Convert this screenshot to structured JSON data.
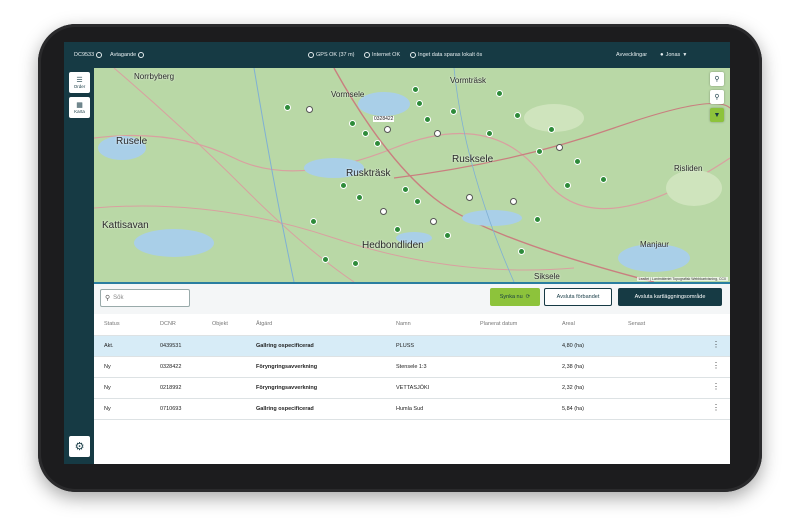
{
  "topbar": {
    "device_id": "DC9533",
    "sync_status": "Avtagande",
    "gps": "GPS OK (37 m)",
    "internet": "Internet OK",
    "offline_data": "Inget data sparas lokalt ös",
    "settings": "Avvecklingar",
    "user": "Jonas"
  },
  "sidebar": {
    "items": [
      {
        "label": "Order",
        "icon": "list-icon"
      },
      {
        "label": "Karta",
        "icon": "map-icon"
      }
    ],
    "settings_icon": "gear-icon"
  },
  "map": {
    "places": [
      "Norrbyberg",
      "Vormsele",
      "Vormträsk",
      "Ruselе",
      "Rusksele",
      "Ruskträsk",
      "Risliden",
      "Kattisavan",
      "Hedbondliden",
      "Manjaur",
      "Sikselе"
    ],
    "selected_label": "0328422",
    "attribution": "Leaflet | Lantmäteriet Topografisk Webbkartvisning, CC0"
  },
  "toolbar": {
    "search_placeholder": "Sök",
    "sync_button": "Synka nu",
    "reference_button": "Avsluta förbandet",
    "plan_button": "Avsluta kartläggningsområde"
  },
  "table": {
    "headers": [
      "Status",
      "DCNR",
      "Objekt",
      "Åtgärd",
      "Namn",
      "Planerat datum",
      "Areal",
      "Senast"
    ],
    "rows": [
      {
        "status": "Akt.",
        "dcnr": "0439531",
        "action": "Gallring ospecificerad",
        "name": "PLUSS",
        "area": "4,80 (ha)"
      },
      {
        "status": "Ny",
        "dcnr": "0328422",
        "action": "Föryngringsavverkning",
        "name": "Stensele 1:3",
        "area": "2,38 (ha)"
      },
      {
        "status": "Ny",
        "dcnr": "0218992",
        "action": "Föryngringsavverkning",
        "name": "VETTASJÖKI",
        "area": "2,32 (ha)"
      },
      {
        "status": "Ny",
        "dcnr": "0710693",
        "action": "Gallring ospecificerad",
        "name": "Humla Sud",
        "area": "5,84 (ha)"
      }
    ]
  },
  "colors": {
    "header": "#163a44",
    "accent": "#8dc33b",
    "selected_row": "#d7ecf7",
    "map_green": "#b9d8a6"
  }
}
